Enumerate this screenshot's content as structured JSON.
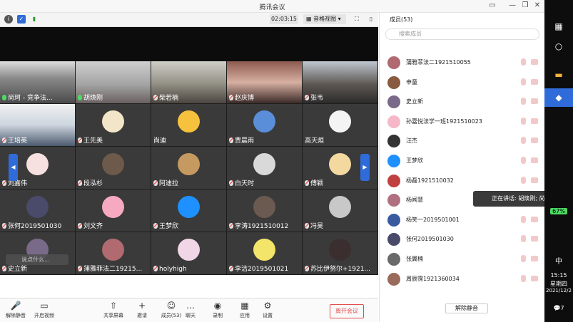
{
  "window": {
    "title": "腾讯会议",
    "controls": [
      "—",
      "❐",
      "—",
      "✕"
    ]
  },
  "toolbar": {
    "time": "02:03:15",
    "view_label": "音格视图"
  },
  "tiles": [
    {
      "name": "尚珂 - 竞争法...",
      "kind": "video1",
      "mic": "on"
    },
    {
      "name": "胡焕刚",
      "kind": "video2",
      "mic": "on"
    },
    {
      "name": "柴若楠",
      "kind": "video3",
      "mic": "off"
    },
    {
      "name": "赵庆博",
      "kind": "video4",
      "mic": "off"
    },
    {
      "name": "张韦",
      "kind": "video5",
      "mic": "off"
    },
    {
      "name": "王培英",
      "kind": "video6",
      "mic": "off"
    },
    {
      "name": "王先美",
      "kind": "avatar",
      "color": "#f3e6c8",
      "mic": "off"
    },
    {
      "name": "尚迪",
      "kind": "avatar",
      "color": "#f6c23d",
      "mic": "none"
    },
    {
      "name": "贾晨雨",
      "kind": "avatar",
      "color": "#5a8ed8",
      "mic": "off"
    },
    {
      "name": "高天烜",
      "kind": "avatar",
      "color": "#f4f4f4",
      "mic": "none"
    },
    {
      "name": "刘嘉伟",
      "kind": "avatar",
      "color": "#f6e0e0",
      "mic": "off"
    },
    {
      "name": "段泓杉",
      "kind": "avatar",
      "color": "#6d5a4a",
      "mic": "off"
    },
    {
      "name": "阿迪拉",
      "kind": "avatar",
      "color": "#c49a60",
      "mic": "off"
    },
    {
      "name": "白天时",
      "kind": "avatar",
      "color": "#d9d9d9",
      "mic": "off"
    },
    {
      "name": "傅颖",
      "kind": "avatar",
      "color": "#f3d9a0",
      "mic": "off"
    },
    {
      "name": "张何2019501030",
      "kind": "avatar",
      "color": "#4a4a6a",
      "mic": "off"
    },
    {
      "name": "刘文齐",
      "kind": "avatar",
      "color": "#f6a9c0",
      "mic": "off"
    },
    {
      "name": "王梦欣",
      "kind": "avatar",
      "color": "#1e90ff",
      "mic": "off"
    },
    {
      "name": "李涛1921510012",
      "kind": "avatar",
      "color": "#6a5a50",
      "mic": "off"
    },
    {
      "name": "冯昊",
      "kind": "avatar",
      "color": "#c8c8c8",
      "mic": "off"
    },
    {
      "name": "史立新",
      "kind": "avatar",
      "color": "#7a6a8a",
      "mic": "off"
    },
    {
      "name": "蒲雅菲法二19215...",
      "kind": "avatar",
      "color": "#b06a70",
      "mic": "off"
    },
    {
      "name": "holyhigh",
      "kind": "avatar",
      "color": "#f0d6e6",
      "mic": "off"
    },
    {
      "name": "李洁2019501021",
      "kind": "avatar",
      "color": "#f3e46a",
      "mic": "off"
    },
    {
      "name": "苏比伊努尔+1921...",
      "kind": "avatar",
      "color": "#3a2e2e",
      "mic": "off"
    }
  ],
  "chat": {
    "placeholder": "说点什么..."
  },
  "bottombar": {
    "items": [
      {
        "label": "解除静音",
        "glyph": "🎤"
      },
      {
        "label": "开启视频",
        "glyph": "▭"
      },
      {
        "label": "共享屏幕",
        "glyph": "⇧"
      },
      {
        "label": "邀请",
        "glyph": "+"
      },
      {
        "label": "成员(53)",
        "glyph": "☺"
      },
      {
        "label": "聊天",
        "glyph": "…"
      },
      {
        "label": "录制",
        "glyph": "◉"
      },
      {
        "label": "应用",
        "glyph": "▦"
      },
      {
        "label": "设置",
        "glyph": "⚙"
      }
    ],
    "leave_label": "离开会议"
  },
  "panel": {
    "title": "成员(53)",
    "search_placeholder": "搜索成员",
    "members": [
      {
        "name": "蒲雅菲法二1921510055",
        "color": "#b06a70"
      },
      {
        "name": "申童",
        "color": "#8a5a40"
      },
      {
        "name": "史立新",
        "color": "#7a6a8a"
      },
      {
        "name": "孙嘉悦法学一班1921510023",
        "color": "#f6b8c8"
      },
      {
        "name": "汪杰",
        "color": "#333333"
      },
      {
        "name": "王梦欣",
        "color": "#1e90ff"
      },
      {
        "name": "杨磊1921510032",
        "color": "#c04040"
      },
      {
        "name": "杨闻慧",
        "color": "#b07080"
      },
      {
        "name": "杨笑一2019501001",
        "color": "#3a5aa0"
      },
      {
        "name": "张何2019501030",
        "color": "#4a4a6a"
      },
      {
        "name": "张翼楠",
        "color": "#6a6a6a"
      },
      {
        "name": "周辰霈1921360034",
        "color": "#9a6a5a"
      }
    ],
    "unmute_label": "解除静音",
    "speaking_label": "正在讲话: 胡焕刚; 尚珂"
  },
  "taskbar": {
    "battery": "67%",
    "ime": "中",
    "clock_time": "15:15",
    "clock_day": "星期四",
    "clock_date": "2021/12/2",
    "notif_count": "7"
  }
}
